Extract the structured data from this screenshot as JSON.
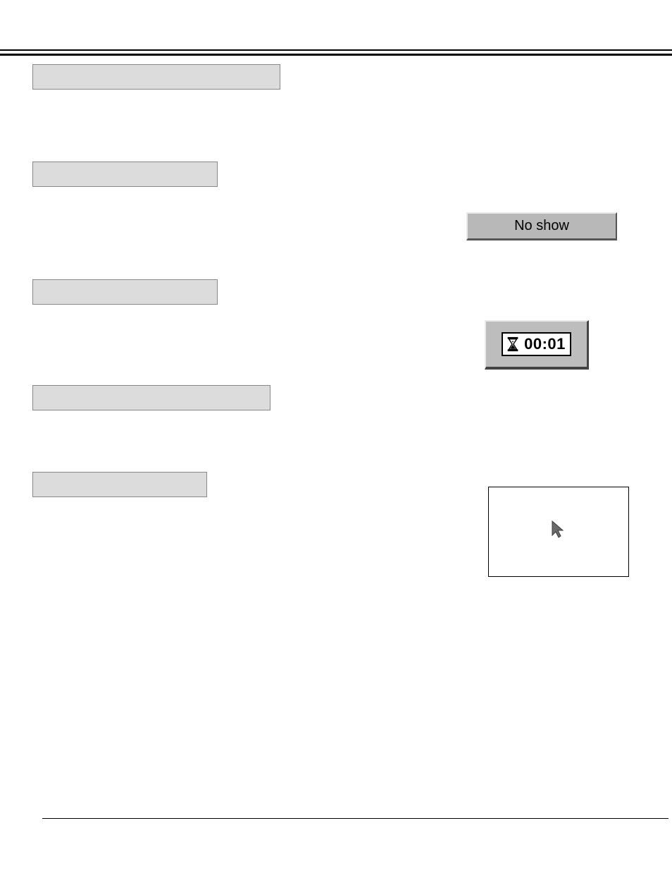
{
  "buttons": {
    "no_show_label": "No show"
  },
  "timer": {
    "value": "00:01"
  }
}
